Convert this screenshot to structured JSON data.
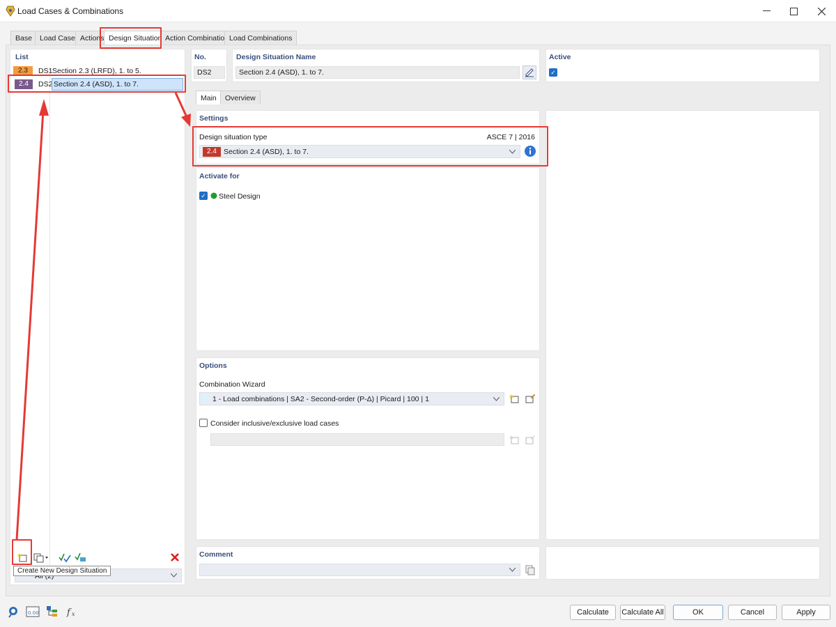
{
  "window": {
    "title": "Load Cases & Combinations"
  },
  "tabs": [
    {
      "label": "Base"
    },
    {
      "label": "Load Cases"
    },
    {
      "label": "Actions"
    },
    {
      "label": "Design Situations"
    },
    {
      "label": "Action Combinations"
    },
    {
      "label": "Load Combinations"
    }
  ],
  "list": {
    "title": "List",
    "items": [
      {
        "badge": "2.3",
        "id": "DS1",
        "name": "Section 2.3 (LRFD), 1. to 5.",
        "badge_color": "#f39c3d"
      },
      {
        "badge": "2.4",
        "id": "DS2",
        "name": "Section 2.4 (ASD), 1. to 7.",
        "badge_color": "#7a5a8c"
      }
    ],
    "filter_value": "All (2)",
    "tooltip": "Create New Design Situation"
  },
  "header": {
    "no_label": "No.",
    "no_value": "DS2",
    "name_label": "Design Situation Name",
    "name_value": "Section 2.4 (ASD), 1. to 7.",
    "active_label": "Active"
  },
  "subtabs": [
    {
      "label": "Main"
    },
    {
      "label": "Overview"
    }
  ],
  "settings": {
    "title": "Settings",
    "type_label": "Design situation type",
    "standard": "ASCE 7 | 2016",
    "type_badge": "2.4",
    "type_badge_color": "#c0392b",
    "type_value": "Section 2.4 (ASD), 1. to 7."
  },
  "activate": {
    "title": "Activate for",
    "item": "Steel Design",
    "dot_color": "#1e9e2f"
  },
  "options": {
    "title": "Options",
    "wizard_label": "Combination Wizard",
    "wizard_value": "1 - Load combinations | SA2 - Second-order (P-Δ) | Picard | 100 | 1",
    "inclusive_label": "Consider inclusive/exclusive load cases"
  },
  "comment": {
    "title": "Comment"
  },
  "footer": {
    "calculate": "Calculate",
    "calculate_all": "Calculate All",
    "ok": "OK",
    "cancel": "Cancel",
    "apply": "Apply"
  },
  "colors": {
    "accent": "#1f6fc5",
    "highlight": "#e53935",
    "section": "#3a4f7a"
  }
}
